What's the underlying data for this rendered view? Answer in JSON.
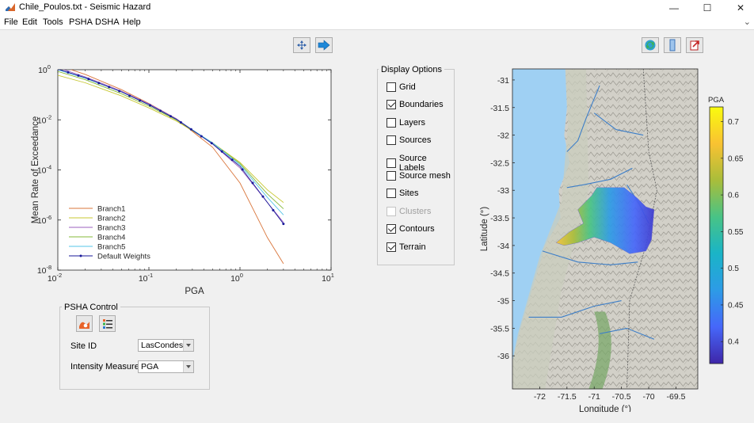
{
  "window": {
    "title": "Chile_Poulos.txt - Seismic Hazard",
    "minimize_glyph": "—",
    "maximize_glyph": "☐",
    "close_glyph": "✕"
  },
  "menu": {
    "items": [
      "File",
      "Edit",
      "Tools",
      "PSHA",
      "DSHA",
      "Help"
    ],
    "pin_glyph": "⌄"
  },
  "toolbar": {
    "pan_icon": "four-arrow-pan-icon",
    "forward_icon": "blue-right-arrow-icon",
    "refresh_icon": "green-refresh-icon",
    "colorbar_icon": "colorbar-toggle-icon",
    "export_icon": "red-export-icon"
  },
  "hazard_plot": {
    "chart_data": {
      "type": "line",
      "xlabel": "PGA",
      "ylabel": "Mean Rate of Exceedance",
      "xscale": "log",
      "yscale": "log",
      "xlim": [
        0.01,
        10
      ],
      "ylim": [
        1e-08,
        1
      ],
      "x_ticks": [
        "10",
        "10",
        "10",
        "10"
      ],
      "x_tick_exponents": [
        "-2",
        "-1",
        "0",
        "1"
      ],
      "y_ticks": [
        "10",
        "10",
        "10",
        "10",
        "10"
      ],
      "y_tick_exponents": [
        "0",
        "-2",
        "-4",
        "-6",
        "-8"
      ],
      "y_tick_values": [
        1,
        0.01,
        0.0001,
        1e-06,
        1e-08
      ],
      "x_tick_values": [
        0.01,
        0.1,
        1,
        10
      ],
      "legend_position": "bottom-left",
      "x": [
        0.01,
        0.02,
        0.05,
        0.1,
        0.2,
        0.5,
        1,
        2,
        3
      ],
      "series": [
        {
          "name": "Branch1",
          "color": "#d9753b",
          "values": [
            1.5,
            0.65,
            0.16,
            0.045,
            0.011,
            0.0008,
            3e-05,
            2e-07,
            1.8e-08
          ]
        },
        {
          "name": "Branch2",
          "color": "#c8c832",
          "values": [
            0.6,
            0.3,
            0.09,
            0.03,
            0.009,
            0.0012,
            0.0002,
            1.6e-05,
            5e-06
          ]
        },
        {
          "name": "Branch3",
          "color": "#9b5fbf",
          "values": [
            1.2,
            0.52,
            0.14,
            0.043,
            0.011,
            0.0011,
            0.00012,
            5e-06,
            8e-07
          ]
        },
        {
          "name": "Branch4",
          "color": "#84b838",
          "values": [
            0.85,
            0.4,
            0.11,
            0.035,
            0.01,
            0.0012,
            0.00018,
            1.1e-05,
            2.8e-06
          ]
        },
        {
          "name": "Branch5",
          "color": "#55c4e8",
          "values": [
            1.0,
            0.46,
            0.13,
            0.04,
            0.0105,
            0.0012,
            0.00016,
            8e-06,
            1.6e-06
          ]
        },
        {
          "name": "Default Weights",
          "color": "#1a1a9a",
          "marker": "dot",
          "values": [
            1.05,
            0.48,
            0.13,
            0.04,
            0.0105,
            0.0011,
            0.00014,
            5e-06,
            7e-07
          ]
        }
      ]
    }
  },
  "display_options": {
    "title": "Display Options",
    "items": [
      {
        "label": "Grid",
        "checked": false,
        "enabled": true
      },
      {
        "label": "Boundaries",
        "checked": true,
        "enabled": true
      },
      {
        "label": "Layers",
        "checked": false,
        "enabled": true
      },
      {
        "label": "Sources",
        "checked": false,
        "enabled": true
      },
      {
        "label": "Source Labels",
        "checked": false,
        "enabled": true
      },
      {
        "label": "Source mesh",
        "checked": false,
        "enabled": true
      },
      {
        "label": "Sites",
        "checked": false,
        "enabled": true
      },
      {
        "label": "Clusters",
        "checked": false,
        "enabled": false
      },
      {
        "label": "Contours",
        "checked": true,
        "enabled": true
      },
      {
        "label": "Terrain",
        "checked": true,
        "enabled": true
      }
    ]
  },
  "psha_control": {
    "title": "PSHA Control",
    "run_icon": "orange-run-psha-icon",
    "list_icon": "list-icon",
    "site_label": "Site ID",
    "site_value": "LasCondes",
    "measure_label": "Intensity Measure",
    "measure_value": "PGA"
  },
  "map": {
    "chart_data": {
      "type": "heatmap",
      "xlabel": "Longitude (°)",
      "ylabel": "Latitude (°)",
      "xlim": [
        -72.5,
        -69.1
      ],
      "ylim": [
        -36.6,
        -30.8
      ],
      "x_ticks": [
        "-72",
        "-71.5",
        "-71",
        "-70.5",
        "-70",
        "-69.5"
      ],
      "x_tick_values": [
        -72,
        -71.5,
        -71,
        -70.5,
        -70,
        -69.5
      ],
      "y_ticks": [
        "-31",
        "-31.5",
        "-32",
        "-32.5",
        "-33",
        "-33.5",
        "-34",
        "-34.5",
        "-35",
        "-35.5",
        "-36"
      ],
      "y_tick_values": [
        -31,
        -31.5,
        -32,
        -32.5,
        -33,
        -33.5,
        -34,
        -34.5,
        -35,
        -35.5,
        -36
      ],
      "colorbar_label": "PGA",
      "colorbar_range": [
        0.37,
        0.72
      ],
      "colorbar_ticks": [
        "0.7",
        "0.65",
        "0.6",
        "0.55",
        "0.5",
        "0.45",
        "0.4"
      ],
      "colorbar_tick_values": [
        0.7,
        0.65,
        0.6,
        0.55,
        0.5,
        0.45,
        0.4
      ],
      "colormap": [
        "#3e26a8",
        "#4667fa",
        "#2d9be6",
        "#1ab4c7",
        "#48c386",
        "#a9bd3a",
        "#f9c232",
        "#f9fb0e"
      ]
    }
  }
}
